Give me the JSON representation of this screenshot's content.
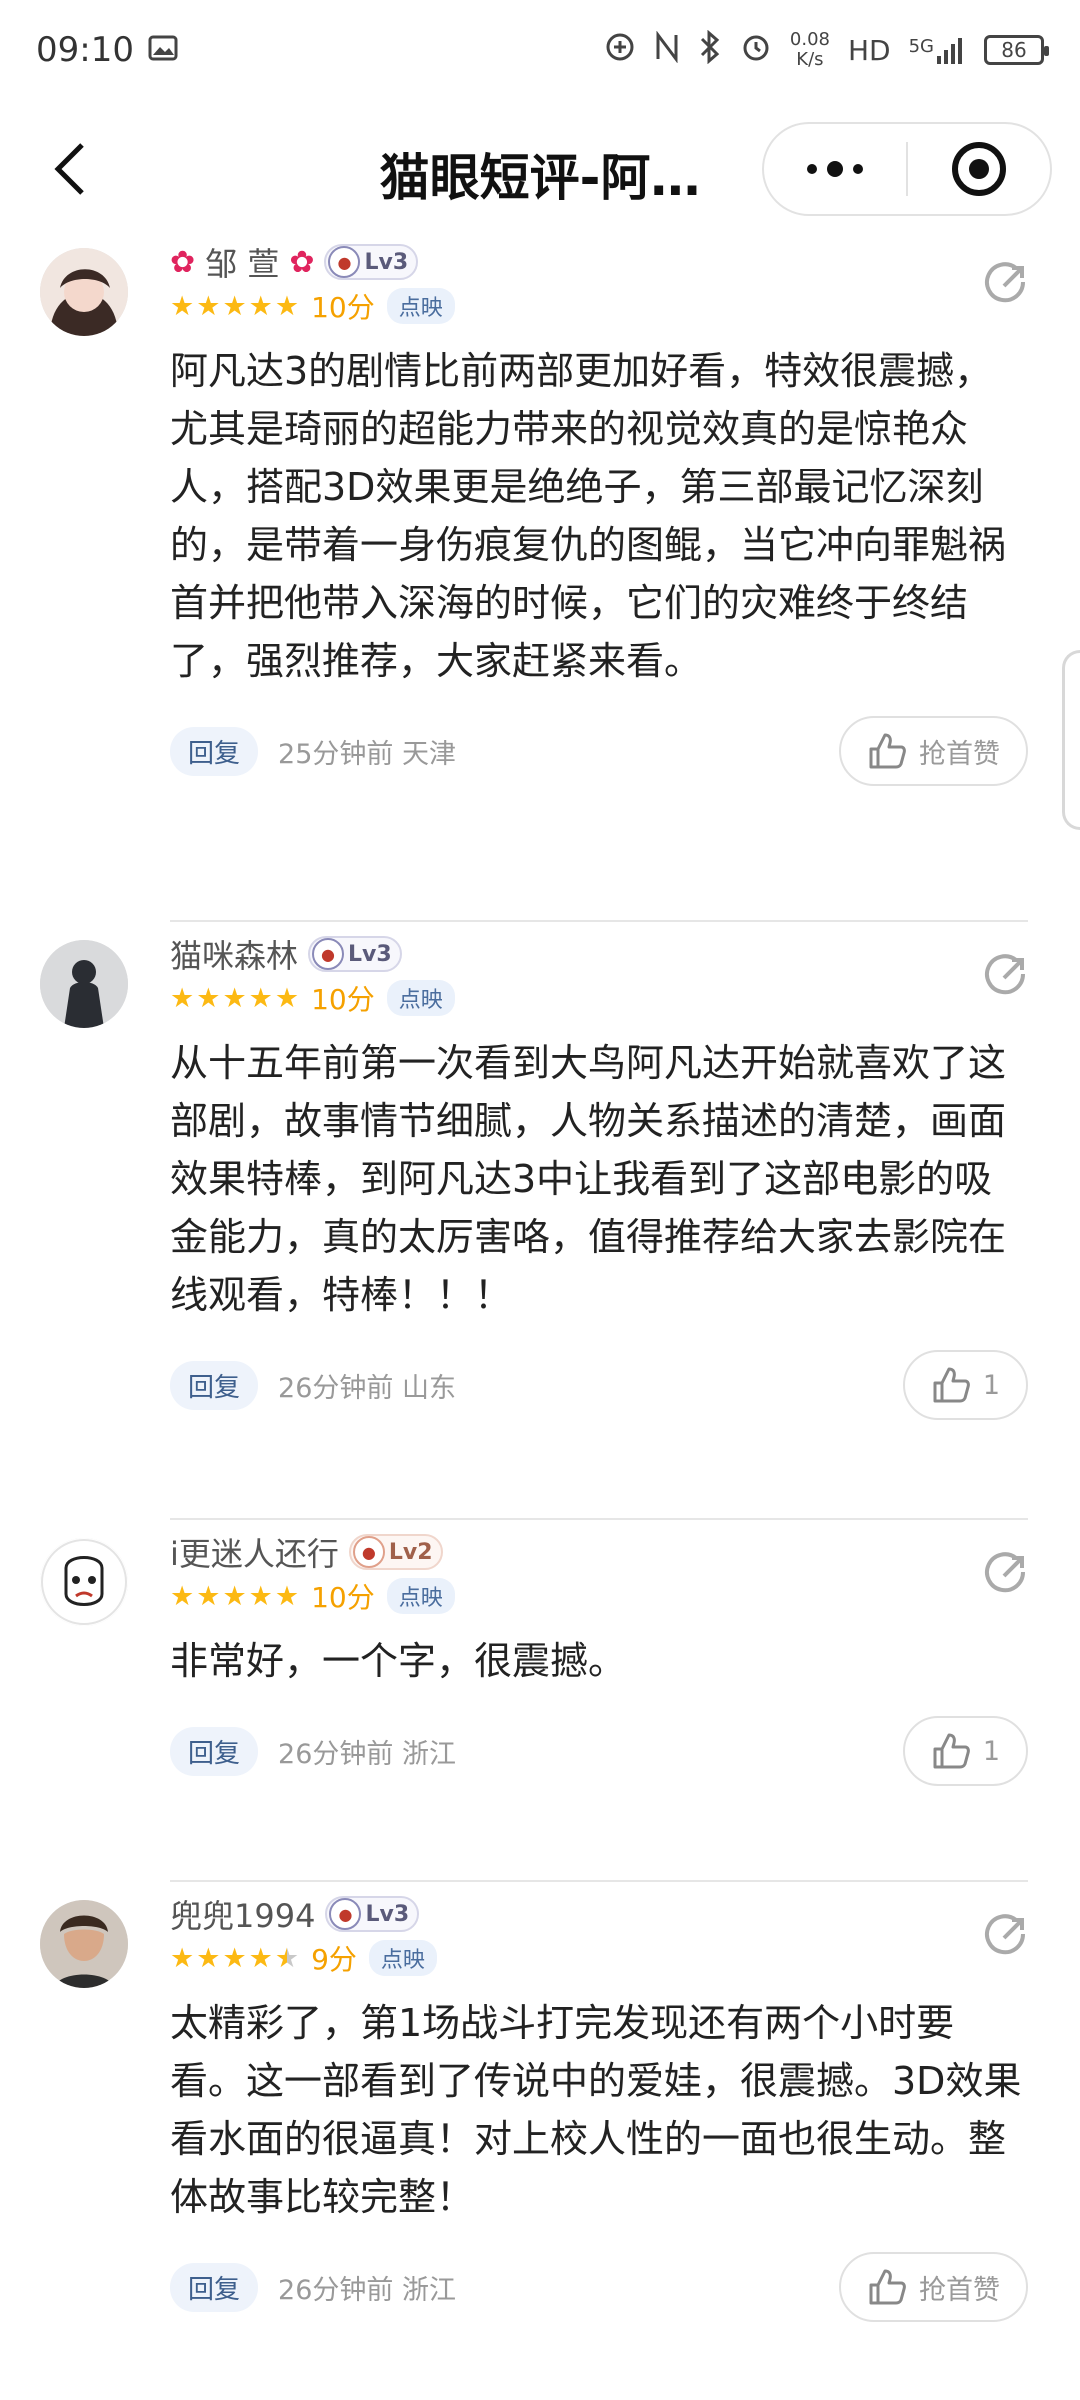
{
  "status_bar": {
    "time": "09:10",
    "net_speed_value": "0.08",
    "net_speed_unit": "K/s",
    "hd_label": "HD",
    "network_label": "5G",
    "battery": "86"
  },
  "nav": {
    "title": "猫眼短评-阿…"
  },
  "reviews": [
    {
      "user_name": "邹 萱",
      "level": "Lv3",
      "score": "10分",
      "tag": "点映",
      "stars": 5,
      "content": "阿凡达3的剧情比前两部更加好看，特效很震撼，尤其是琦丽的超能力带来的视觉效真的是惊艳众人，搭配3D效果更是绝绝子，第三部最记忆深刻的，是带着一身伤痕复仇的图鲲，当它冲向罪魁祸首并把他带入深海的时候，它们的灾难终于终结了，强烈推荐，大家赶紧来看。",
      "reply_label": "回复",
      "meta": "25分钟前 天津",
      "like_label": "抢首赞"
    },
    {
      "user_name": "猫咪森林",
      "level": "Lv3",
      "score": "10分",
      "tag": "点映",
      "stars": 5,
      "content": "从十五年前第一次看到大鸟阿凡达开始就喜欢了这部剧，故事情节细腻，人物关系描述的清楚，画面效果特棒，到阿凡达3中让我看到了这部电影的吸金能力，真的太厉害咯，值得推荐给大家去影院在线观看，特棒！！！",
      "reply_label": "回复",
      "meta": "26分钟前 山东",
      "like_label": "1"
    },
    {
      "user_name": "i更迷人还行",
      "level": "Lv2",
      "score": "10分",
      "tag": "点映",
      "stars": 5,
      "content": "非常好，一个字，很震撼。",
      "reply_label": "回复",
      "meta": "26分钟前 浙江",
      "like_label": "1"
    },
    {
      "user_name": "兜兜1994",
      "level": "Lv3",
      "score": "9分",
      "tag": "点映",
      "stars": 4.5,
      "content": "太精彩了，第1场战斗打完发现还有两个小时要看。这一部看到了传说中的爱娃，很震撼。3D效果看水面的很逼真！对上校人性的一面也很生动。整体故事比较完整！",
      "reply_label": "回复",
      "meta": "26分钟前 浙江",
      "like_label": "抢首赞"
    }
  ]
}
